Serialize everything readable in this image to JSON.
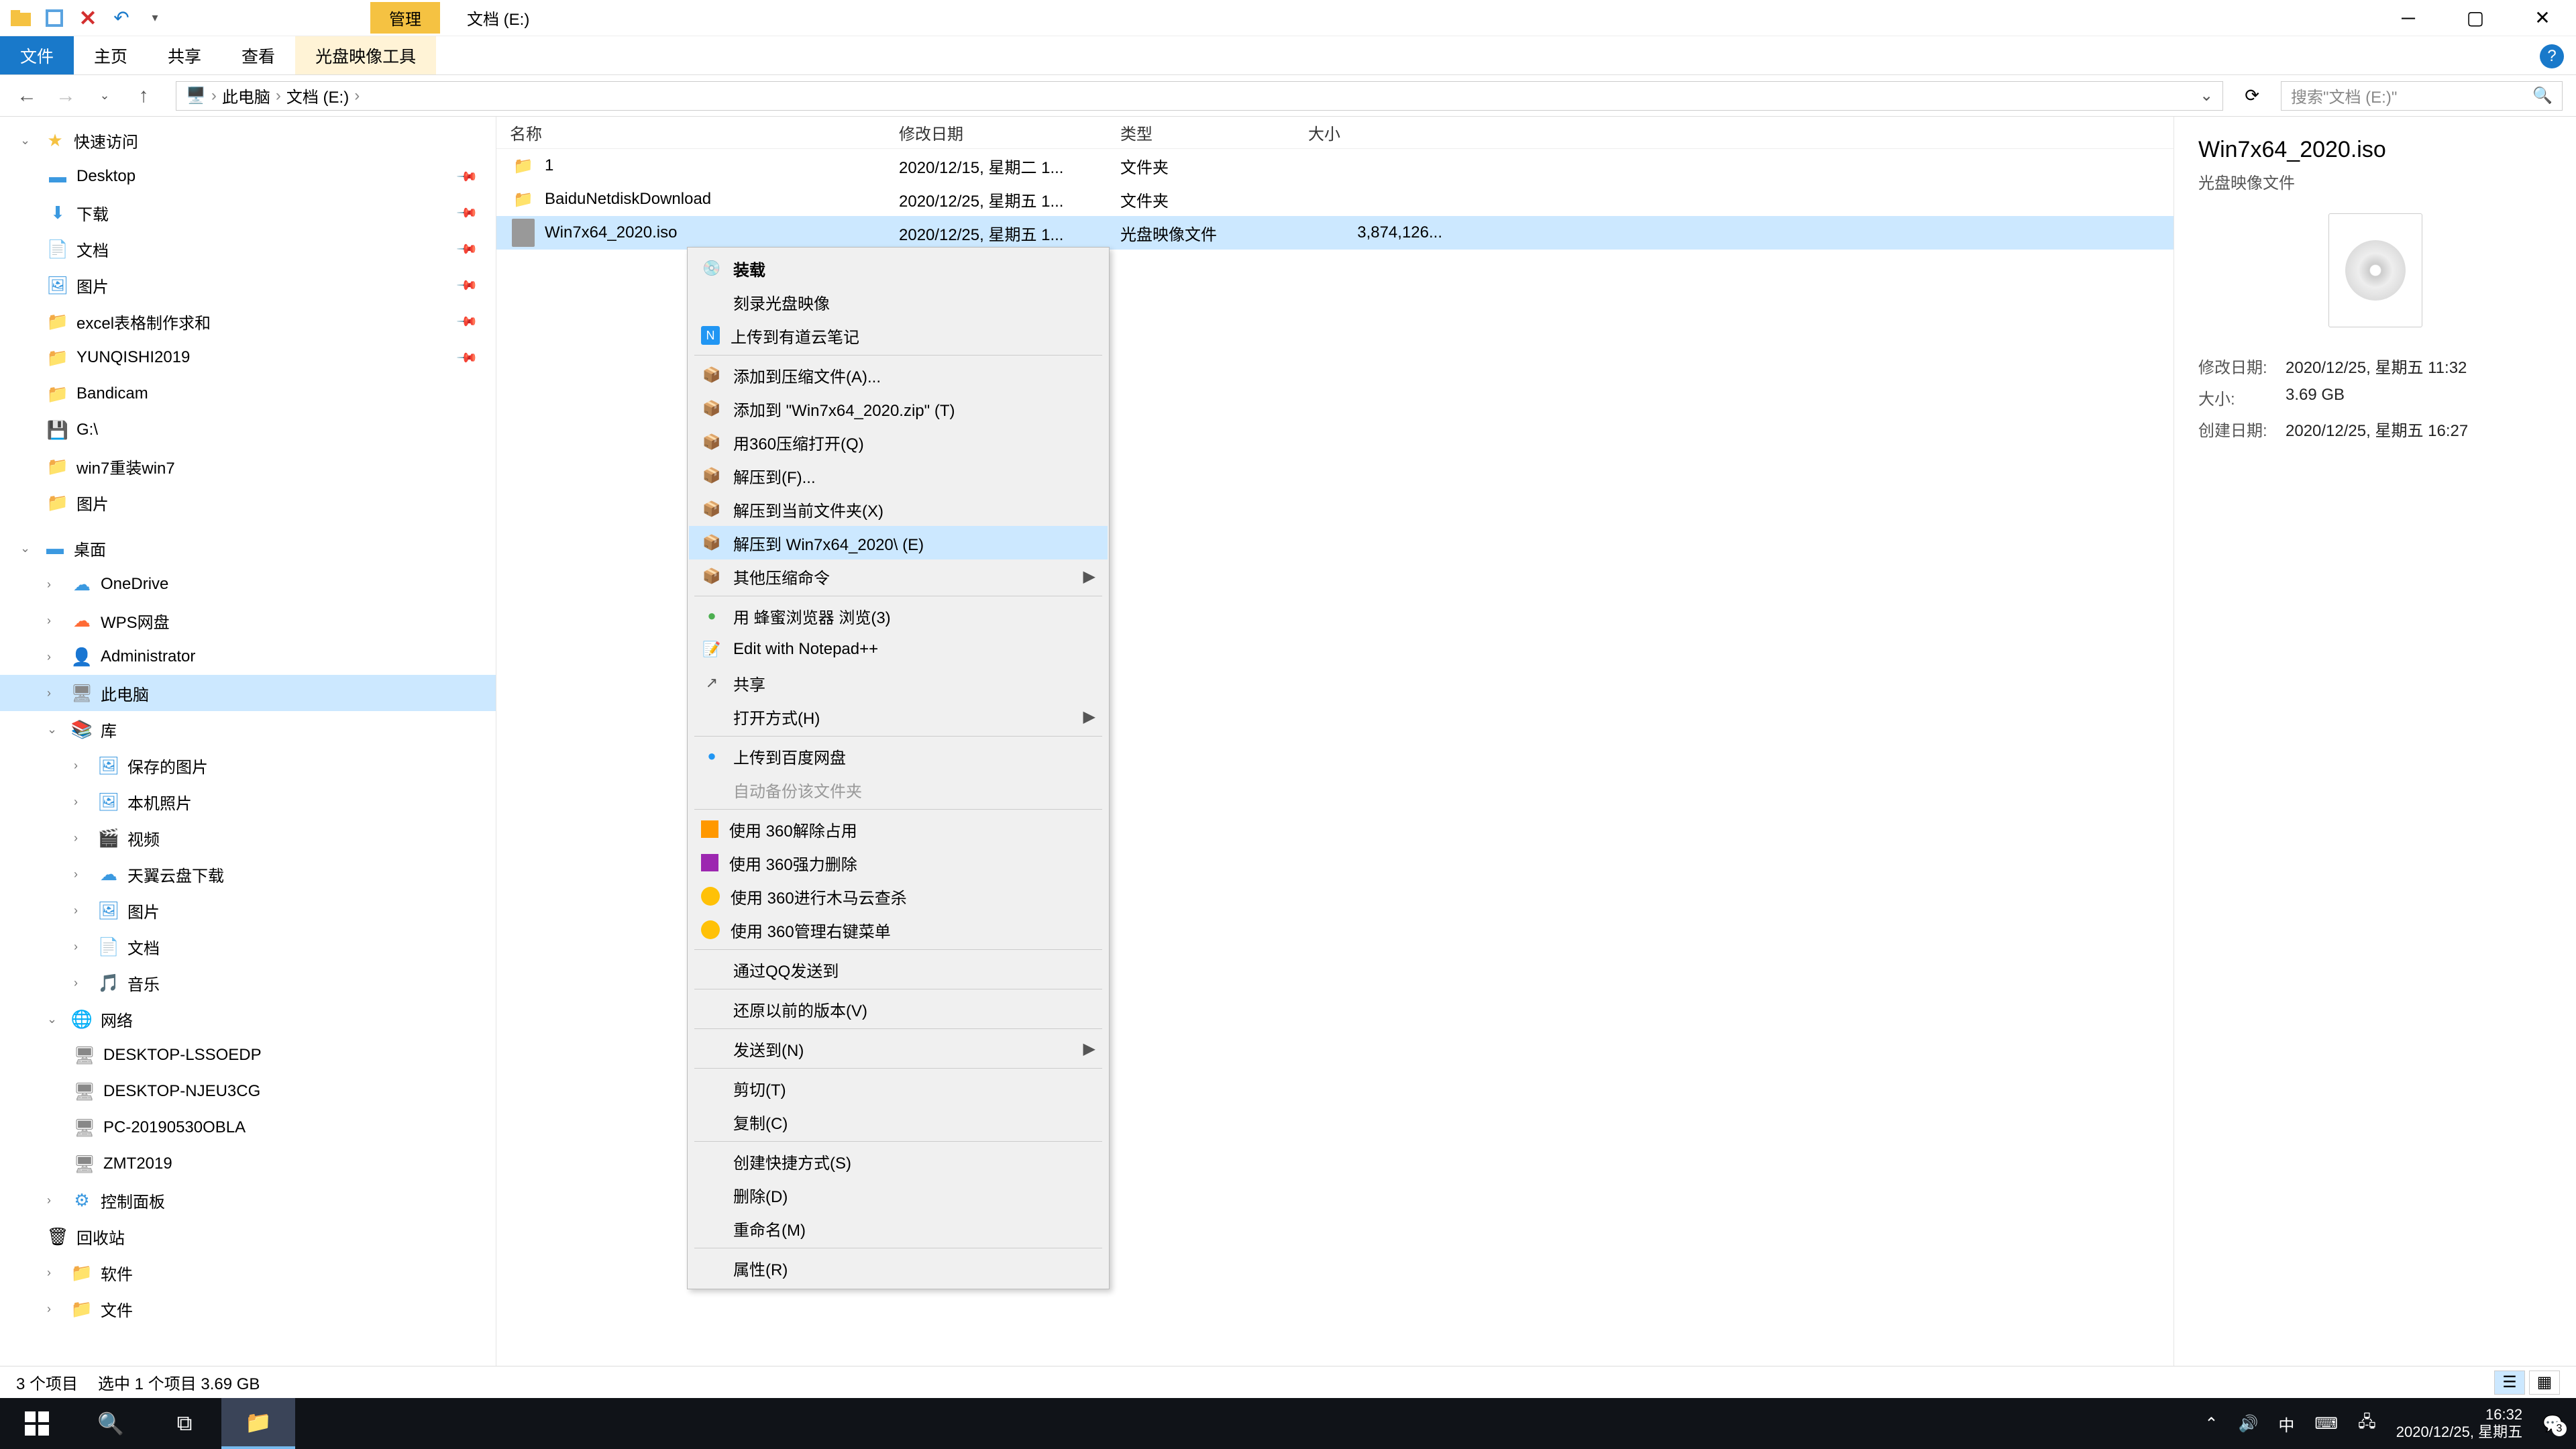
{
  "titlebar": {
    "tab": "管理",
    "title": "文档 (E:)"
  },
  "ribbon": {
    "file": "文件",
    "home": "主页",
    "share": "共享",
    "view": "查看",
    "iso_tools": "光盘映像工具"
  },
  "address": {
    "root": "此电脑",
    "loc": "文档 (E:)",
    "search_placeholder": "搜索\"文档 (E:)\""
  },
  "tree": {
    "quick": "快速访问",
    "desktop": "Desktop",
    "downloads": "下载",
    "documents": "文档",
    "pictures_qa": "图片",
    "excel": "excel表格制作求和",
    "yunqishi": "YUNQISHI2019",
    "bandicam": "Bandicam",
    "gdrive": "G:\\",
    "win7reinstall": "win7重装win7",
    "pictures2": "图片",
    "desktop_cn": "桌面",
    "onedrive": "OneDrive",
    "wps": "WPS网盘",
    "admin": "Administrator",
    "thispc": "此电脑",
    "libraries": "库",
    "saved_pics": "保存的图片",
    "camera_roll": "本机照片",
    "videos": "视频",
    "tianyi": "天翼云盘下载",
    "pictures_lib": "图片",
    "docs_lib": "文档",
    "music_lib": "音乐",
    "network": "网络",
    "pc1": "DESKTOP-LSSOEDP",
    "pc2": "DESKTOP-NJEU3CG",
    "pc3": "PC-20190530OBLA",
    "pc4": "ZMT2019",
    "ctrlpanel": "控制面板",
    "recycle": "回收站",
    "software": "软件",
    "files": "文件"
  },
  "columns": {
    "name": "名称",
    "date": "修改日期",
    "type": "类型",
    "size": "大小"
  },
  "files": [
    {
      "name": "1",
      "date": "2020/12/15, 星期二 1...",
      "type": "文件夹",
      "size": "",
      "icon": "folder"
    },
    {
      "name": "BaiduNetdiskDownload",
      "date": "2020/12/25, 星期五 1...",
      "type": "文件夹",
      "size": "",
      "icon": "folder"
    },
    {
      "name": "Win7x64_2020.iso",
      "date": "2020/12/25, 星期五 1...",
      "type": "光盘映像文件",
      "size": "3,874,126...",
      "icon": "iso",
      "sel": true
    }
  ],
  "details": {
    "title": "Win7x64_2020.iso",
    "type": "光盘映像文件",
    "mod_k": "修改日期:",
    "mod_v": "2020/12/25, 星期五 11:32",
    "size_k": "大小:",
    "size_v": "3.69 GB",
    "created_k": "创建日期:",
    "created_v": "2020/12/25, 星期五 16:27"
  },
  "ctx": [
    {
      "t": "装载",
      "bold": true,
      "icon": "disc"
    },
    {
      "t": "刻录光盘映像"
    },
    {
      "t": "上传到有道云笔记",
      "icon": "note"
    },
    {
      "sep": true
    },
    {
      "t": "添加到压缩文件(A)...",
      "icon": "zip"
    },
    {
      "t": "添加到 \"Win7x64_2020.zip\" (T)",
      "icon": "zip"
    },
    {
      "t": "用360压缩打开(Q)",
      "icon": "zip"
    },
    {
      "t": "解压到(F)...",
      "icon": "zip"
    },
    {
      "t": "解压到当前文件夹(X)",
      "icon": "zip"
    },
    {
      "t": "解压到 Win7x64_2020\\ (E)",
      "icon": "zip",
      "hover": true
    },
    {
      "t": "其他压缩命令",
      "icon": "zip",
      "arrow": true
    },
    {
      "sep": true
    },
    {
      "t": "用 蜂蜜浏览器 浏览(3)",
      "icon": "green-dot"
    },
    {
      "t": "Edit with Notepad++",
      "icon": "npp"
    },
    {
      "t": "共享",
      "icon": "share"
    },
    {
      "t": "打开方式(H)",
      "arrow": true
    },
    {
      "sep": true
    },
    {
      "t": "上传到百度网盘",
      "icon": "blue-dot"
    },
    {
      "t": "自动备份该文件夹",
      "disabled": true
    },
    {
      "sep": true
    },
    {
      "t": "使用 360解除占用",
      "icon": "orange-sq"
    },
    {
      "t": "使用 360强力删除",
      "icon": "purple-sq"
    },
    {
      "t": "使用 360进行木马云查杀",
      "icon": "y360"
    },
    {
      "t": "使用 360管理右键菜单",
      "icon": "y360"
    },
    {
      "sep": true
    },
    {
      "t": "通过QQ发送到"
    },
    {
      "sep": true
    },
    {
      "t": "还原以前的版本(V)"
    },
    {
      "sep": true
    },
    {
      "t": "发送到(N)",
      "arrow": true
    },
    {
      "sep": true
    },
    {
      "t": "剪切(T)"
    },
    {
      "t": "复制(C)"
    },
    {
      "sep": true
    },
    {
      "t": "创建快捷方式(S)"
    },
    {
      "t": "删除(D)"
    },
    {
      "t": "重命名(M)"
    },
    {
      "sep": true
    },
    {
      "t": "属性(R)"
    }
  ],
  "status": {
    "count": "3 个项目",
    "selected": "选中 1 个项目  3.69 GB"
  },
  "taskbar": {
    "time": "16:32",
    "date": "2020/12/25, 星期五",
    "ime": "中",
    "badge": "3"
  }
}
